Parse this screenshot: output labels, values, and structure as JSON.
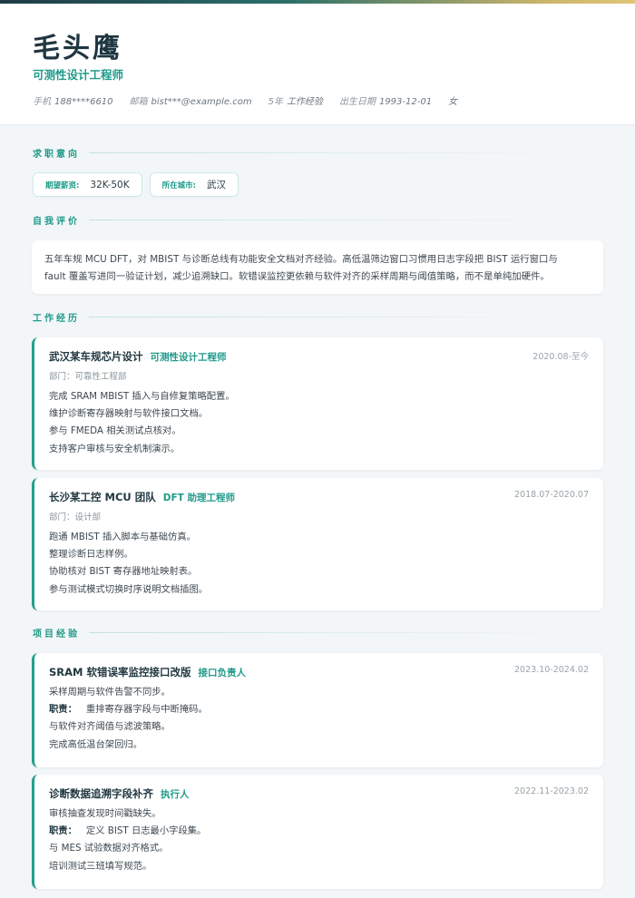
{
  "header": {
    "name": "毛头鹰",
    "title": "可测性设计工程师",
    "contact": [
      {
        "label": "手机",
        "value": "188****6610"
      },
      {
        "label": "邮箱",
        "value": "bist***@example.com"
      },
      {
        "label": "5年",
        "value": "工作经验"
      },
      {
        "label": "出生日期",
        "value": "1993-12-01"
      },
      {
        "label": "",
        "value": "女"
      }
    ]
  },
  "sections": {
    "objective": "求职意向",
    "summary": "自我评价",
    "work": "工作经历",
    "projects": "项目经验"
  },
  "objective": {
    "salary_label": "期望薪资:",
    "salary": "32K-50K",
    "city_label": "所在城市:",
    "city": "武汉"
  },
  "summary": {
    "line1": "五年车规 MCU DFT，对 MBIST 与诊断总线有功能安全文档对齐经验。高低温筛边窗口习惯用日志字段把 BIST 运行窗口与",
    "line2": "fault 覆盖写进同一验证计划，减少追溯缺口。软错误监控更依赖与软件对齐的采样周期与阈值策略，而不是单纯加硬件。"
  },
  "work": [
    {
      "company": "武汉某车规芯片设计",
      "role": "可测性设计工程师",
      "date": "2020.08-至今",
      "dept": "部门：可靠性工程部",
      "items": [
        "完成 SRAM MBIST 插入与自修复策略配置。",
        "维护诊断寄存器映射与软件接口文档。",
        "参与 FMEDA 相关测试点核对。",
        "支持客户审核与安全机制演示。"
      ]
    },
    {
      "company": "长沙某工控 MCU 团队",
      "role": "DFT 助理工程师",
      "date": "2018.07-2020.07",
      "dept": "部门：设计部",
      "items": [
        "跑通 MBIST 插入脚本与基础仿真。",
        "整理诊断日志样例。",
        "协助核对 BIST 寄存器地址映射表。",
        "参与测试模式切换时序说明文档插图。"
      ]
    }
  ],
  "projects": [
    {
      "name": "SRAM 软错误率监控接口改版",
      "role": "接口负责人",
      "date": "2023.10-2024.02",
      "desc": "采样周期与软件告警不同步。",
      "duty_label": "职责：",
      "duty": "重排寄存器字段与中断掩码。",
      "items": [
        "与软件对齐阈值与滤波策略。",
        "完成高低温台架回归。"
      ]
    },
    {
      "name": "诊断数据追溯字段补齐",
      "role": "执行人",
      "date": "2022.11-2023.02",
      "desc": "审核抽查发现时间戳缺失。",
      "duty_label": "职责：",
      "duty": "定义 BIST 日志最小字段集。",
      "items": [
        "与 MES 试验数据对齐格式。",
        "培训测试三班填写规范。"
      ]
    }
  ]
}
